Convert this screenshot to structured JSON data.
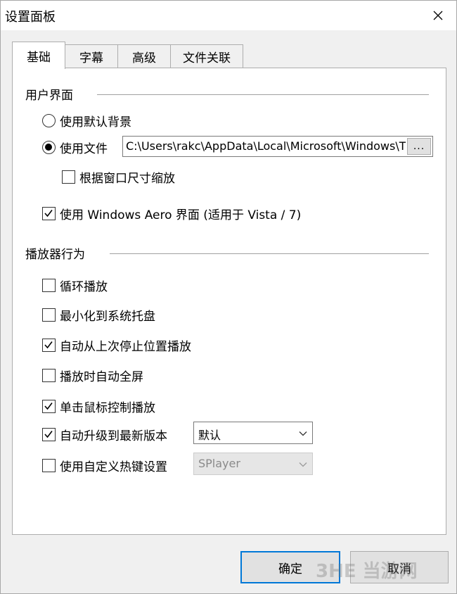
{
  "window": {
    "title": "设置面板"
  },
  "tabs": [
    {
      "label": "基础",
      "active": true
    },
    {
      "label": "字幕",
      "active": false
    },
    {
      "label": "高级",
      "active": false
    },
    {
      "label": "文件关联",
      "active": false
    }
  ],
  "ui_group": {
    "title": "用户界面",
    "default_bg_label": "使用默认背景",
    "default_bg_selected": false,
    "use_file_label": "使用文件",
    "use_file_selected": true,
    "file_path": "C:\\Users\\rakc\\AppData\\Local\\Microsoft\\Windows\\T",
    "browse_label": "...",
    "scale_label": "根据窗口尺寸缩放",
    "scale_checked": false,
    "aero_label": "使用 Windows Aero 界面 (适用于 Vista / 7)",
    "aero_checked": true
  },
  "player_group": {
    "title": "播放器行为",
    "options": [
      {
        "label": "循环播放",
        "checked": false
      },
      {
        "label": "最小化到系统托盘",
        "checked": false
      },
      {
        "label": "自动从上次停止位置播放",
        "checked": true
      },
      {
        "label": "播放时自动全屏",
        "checked": false
      },
      {
        "label": "单击鼠标控制播放",
        "checked": true
      },
      {
        "label": "自动升级到最新版本",
        "checked": true
      },
      {
        "label": "使用自定义热键设置",
        "checked": false
      }
    ],
    "upgrade_select": {
      "value": "默认",
      "enabled": true
    },
    "hotkey_select": {
      "value": "SPlayer",
      "enabled": false
    }
  },
  "buttons": {
    "ok": "确定",
    "cancel": "取消"
  },
  "watermark": "3HE 当游网",
  "colors": {
    "default_button_border": "#0078d7",
    "panel_bg": "#ffffff",
    "window_bg": "#f0f0f0"
  }
}
